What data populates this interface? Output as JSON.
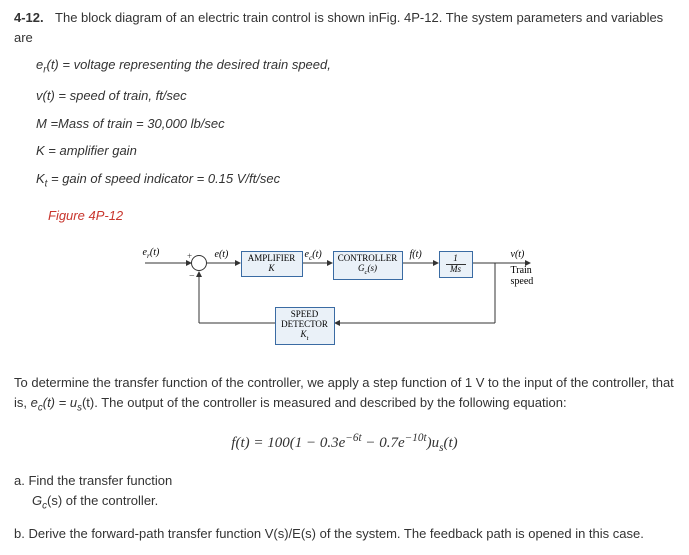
{
  "problem": {
    "number": "4-12.",
    "intro": "The block diagram of an electric train control is shown inFig. 4P-12. The system parameters and variables are",
    "params": {
      "er": "e",
      "er_sub": "r",
      "er_desc": "(t) = voltage representing the desired train speed,",
      "v": "v(t) = speed of train, ft/sec",
      "M": "M =Mass of train = 30,000 lb/sec",
      "K": "K = amplifier gain",
      "Kt": "K",
      "Kt_sub": "t",
      "Kt_desc": " = gain of speed indicator = 0.15 V/ft/sec"
    },
    "figure_label": "Figure 4P-12"
  },
  "diagram": {
    "in_sig": "e",
    "in_sub": "r",
    "in_t": "(t)",
    "err_sig": "e(t)",
    "amp_box_l1": "AMPLIFIER",
    "amp_box_l2": "K",
    "ec_sig": "e",
    "ec_sub": "c",
    "ec_t": "(t)",
    "ctrl_box_l1": "CONTROLLER",
    "ctrl_box_l2": "G",
    "ctrl_box_sub": "c",
    "ctrl_box_arg": "(s)",
    "f_sig": "f(t)",
    "mass_num": "1",
    "mass_den": "Ms",
    "out_sig": "v(t)",
    "out_desc1": "Train",
    "out_desc2": "speed",
    "speed_box_l1": "SPEED",
    "speed_box_l2": "DETECTOR",
    "speed_box_l3": "K",
    "speed_sub": "t"
  },
  "body2": {
    "p1a": "To determine the transfer function of the controller, we apply a step function of 1 V to the input of the controller, that is, ",
    "ec_eq_l": "e",
    "ec_eq_sub": "c",
    "ec_eq_r": "(t) = u",
    "us_sub": "s",
    "ec_eq_end": "(t). The output of the controller is measured and described by the following equation:",
    "f_eq": "f(t) = 100(1 − 0.3e",
    "exp1": "−6t",
    "f_mid": " − 0.7e",
    "exp2": "−10t",
    "f_end": ")u",
    "us_sub2": "s",
    "f_close": "(t)"
  },
  "subq": {
    "a_lead": "a.  Find the transfer function",
    "a_body": "G",
    "a_sub": "c",
    "a_end": "(s) of the controller.",
    "b": "b.  Derive the forward-path transfer function V(s)/E(s) of the system. The feedback path is opened in this case."
  }
}
